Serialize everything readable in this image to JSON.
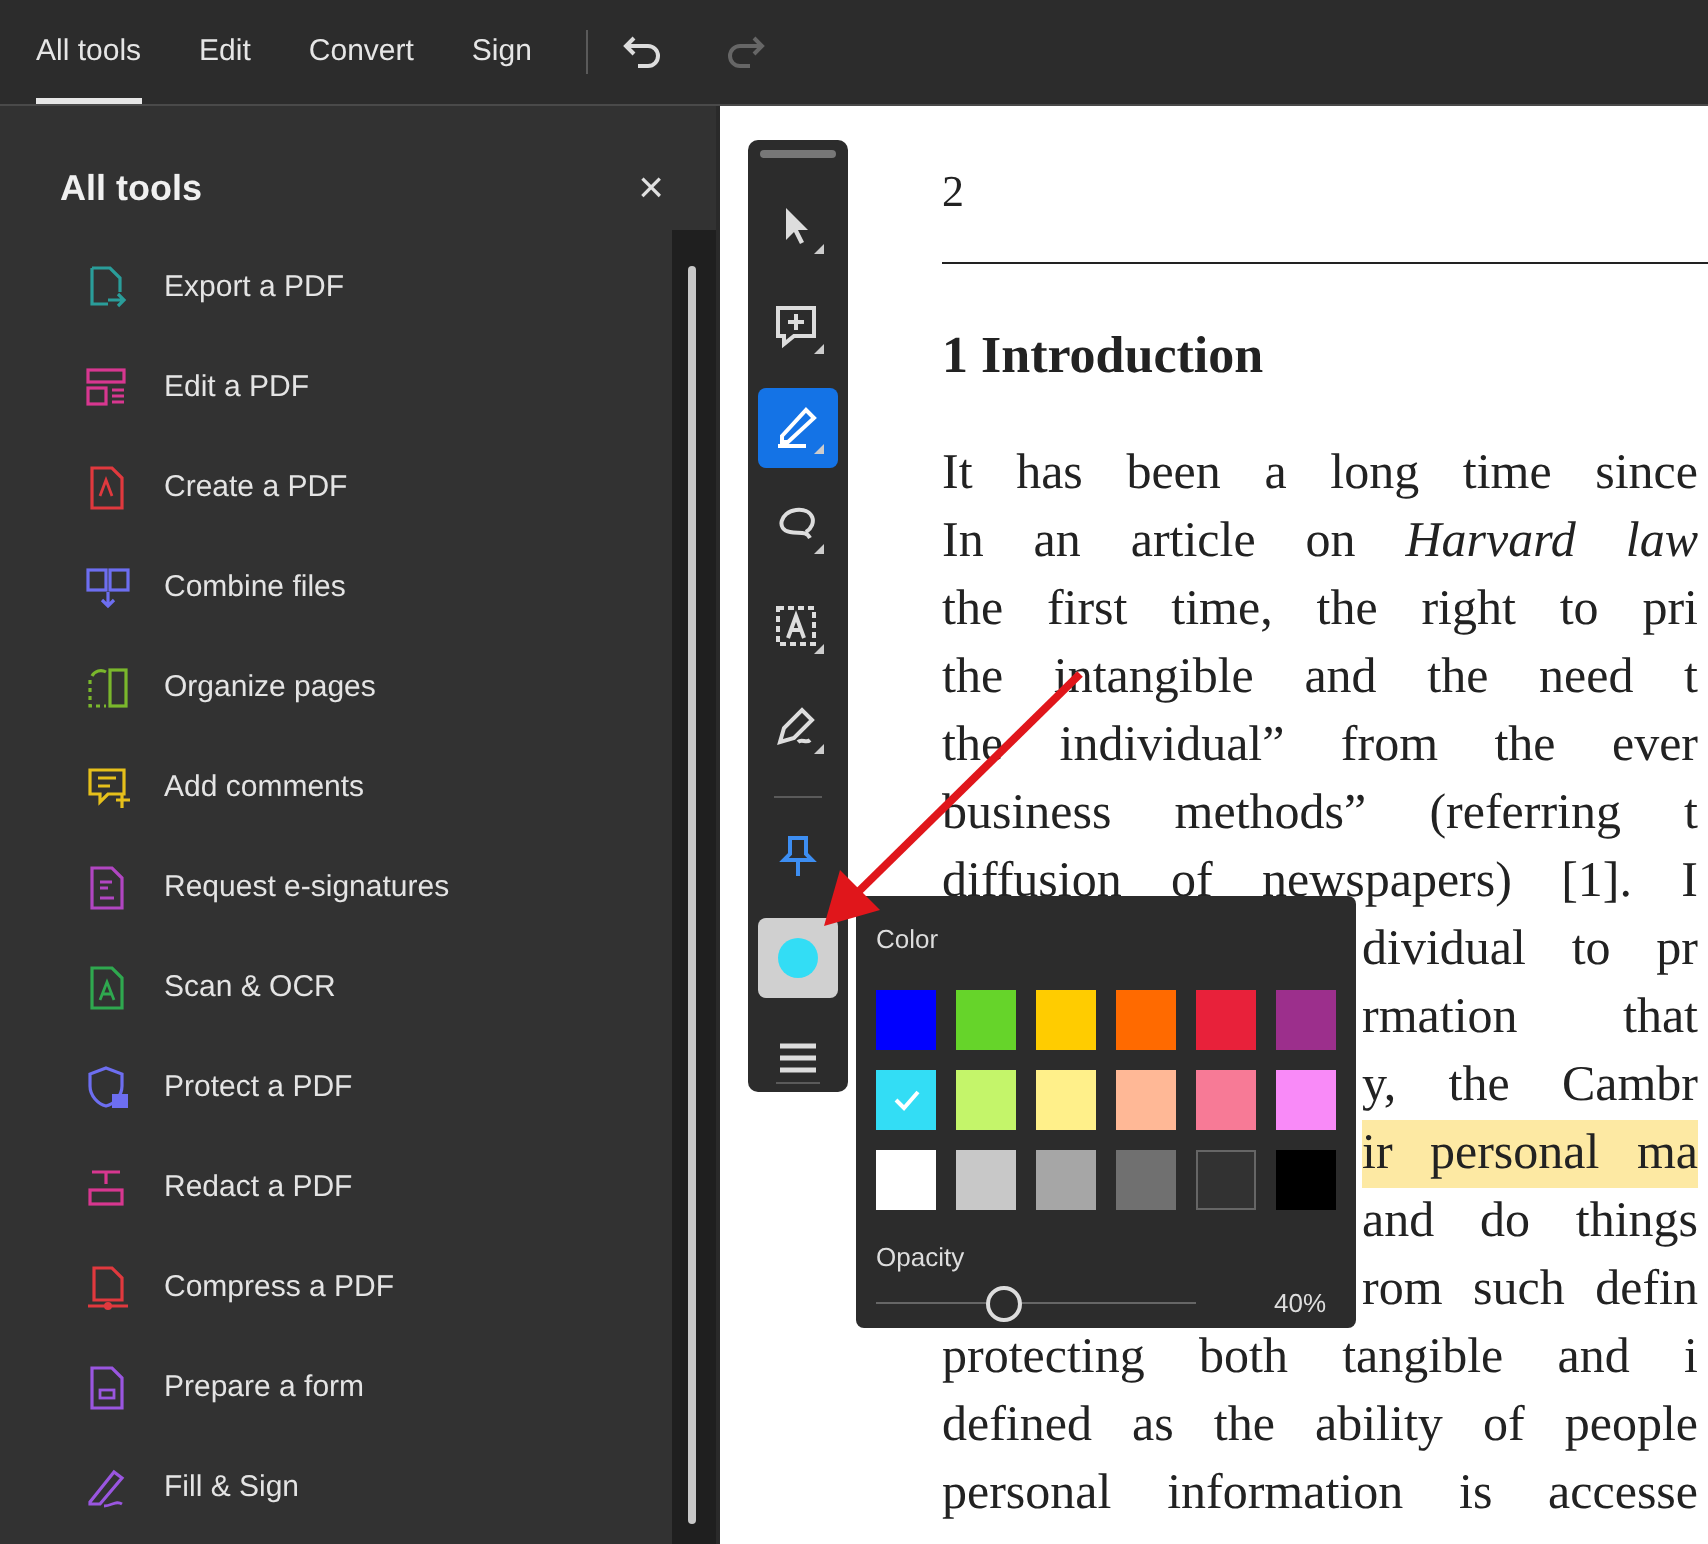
{
  "tabs": [
    {
      "label": "All tools",
      "selected": true
    },
    {
      "label": "Edit",
      "selected": false
    },
    {
      "label": "Convert",
      "selected": false
    },
    {
      "label": "Sign",
      "selected": false
    }
  ],
  "history": [
    {
      "kind": "undo",
      "disabled": false
    },
    {
      "kind": "redo",
      "disabled": true
    }
  ],
  "panel": {
    "title": "All tools",
    "close": "×"
  },
  "tools": [
    {
      "label": "Export a PDF",
      "color": "#2a9d9a"
    },
    {
      "label": "Edit a PDF",
      "color": "#d83790"
    },
    {
      "label": "Create a PDF",
      "color": "#e0393e"
    },
    {
      "label": "Combine files",
      "color": "#6d6ef0"
    },
    {
      "label": "Organize pages",
      "color": "#7ab72c"
    },
    {
      "label": "Add comments",
      "color": "#e6c01b"
    },
    {
      "label": "Request e-signatures",
      "color": "#b146c2"
    },
    {
      "label": "Scan & OCR",
      "color": "#2fa84f"
    },
    {
      "label": "Protect a PDF",
      "color": "#6d6ef0"
    },
    {
      "label": "Redact a PDF",
      "color": "#d83790"
    },
    {
      "label": "Compress a PDF",
      "color": "#e0393e"
    },
    {
      "label": "Prepare a form",
      "color": "#9a56e0"
    },
    {
      "label": "Fill & Sign",
      "color": "#9a56e0"
    }
  ],
  "toolbar": [
    {
      "kind": "select",
      "selected": false
    },
    {
      "kind": "comment",
      "selected": false
    },
    {
      "kind": "highlight",
      "selected": true
    },
    {
      "kind": "draw",
      "selected": false
    },
    {
      "kind": "textbox",
      "selected": false
    },
    {
      "kind": "sign",
      "selected": false
    },
    {
      "kind": "divider"
    },
    {
      "kind": "pin",
      "selected": false
    },
    {
      "kind": "color",
      "color": "#33ddf5",
      "expanded": true
    },
    {
      "kind": "menu",
      "selected": false
    }
  ],
  "color_popup": {
    "label": "Color",
    "swatches": [
      {
        "color": "#0000ff",
        "selected": false
      },
      {
        "color": "#66d42a",
        "selected": false
      },
      {
        "color": "#ffcc00",
        "selected": false
      },
      {
        "color": "#ff6a00",
        "selected": false
      },
      {
        "color": "#e8213a",
        "selected": false
      },
      {
        "color": "#9c2f8c",
        "selected": false
      },
      {
        "color": "#33ddf5",
        "selected": true
      },
      {
        "color": "#c4f56a",
        "selected": false
      },
      {
        "color": "#fff08a",
        "selected": false
      },
      {
        "color": "#ffb896",
        "selected": false
      },
      {
        "color": "#f77a96",
        "selected": false
      },
      {
        "color": "#f98af8",
        "selected": false
      },
      {
        "color": "#ffffff",
        "selected": false
      },
      {
        "color": "#c8c8c8",
        "selected": false
      },
      {
        "color": "#a6a6a6",
        "selected": false
      },
      {
        "color": "#707070",
        "selected": false
      },
      {
        "color": "#323232",
        "selected": false
      },
      {
        "color": "#000000",
        "selected": false
      }
    ],
    "opacity_label": "Opacity",
    "opacity": {
      "level": 0.4
    },
    "opacity_reading": "40%"
  },
  "document": {
    "page_number": "2",
    "heading": "1 Introduction",
    "lines": [
      {
        "text": "It has been a long time since",
        "covered": false,
        "highlighted": false
      },
      {
        "text": "In an article on *Harvard law*",
        "covered": false,
        "highlighted": false
      },
      {
        "text": "the first time, the right to pri",
        "covered": false,
        "highlighted": false
      },
      {
        "text": "the intangible and the need t",
        "covered": false,
        "highlighted": false
      },
      {
        "text": "the individual” from the ever",
        "covered": false,
        "highlighted": false
      },
      {
        "text": "business methods” (referring t",
        "covered": false,
        "highlighted": false
      },
      {
        "text": "diffusion of newspapers) [1]. I",
        "covered": false,
        "highlighted": false
      },
      {
        "text": "dividual to pr",
        "covered": true,
        "highlighted": false
      },
      {
        "text": "rmation that",
        "covered": true,
        "highlighted": false
      },
      {
        "text": "y, the Cambr",
        "covered": true,
        "highlighted": false
      },
      {
        "text": "ir personal ma",
        "covered": true,
        "highlighted": true
      },
      {
        "text": "and do things",
        "covered": true,
        "highlighted": false
      },
      {
        "text": "rom such defin",
        "covered": true,
        "highlighted": false
      },
      {
        "text": "protecting both tangible and i",
        "covered": false,
        "highlighted": false
      },
      {
        "text": "defined as the ability of people",
        "covered": false,
        "highlighted": false
      },
      {
        "text": "personal information is accesse",
        "covered": false,
        "highlighted": false
      }
    ]
  }
}
